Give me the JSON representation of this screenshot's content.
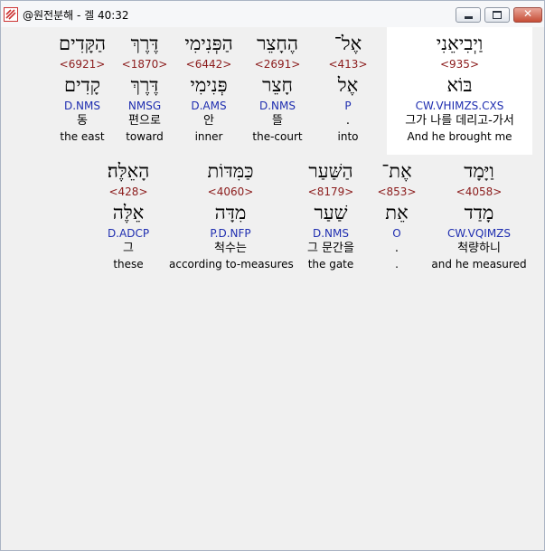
{
  "window": {
    "title": "@원전분해 - 겔 40:32",
    "icon": "app-icon",
    "controls": [
      "minimize-icon",
      "maximize-icon",
      "close-icon"
    ]
  },
  "colors": {
    "strong": "#8b1b1b",
    "morph": "#1f2eb0",
    "highlight_bg": "#ffffff",
    "background": "#f0f0f0"
  },
  "row1": [
    {
      "hebrew": "וַיְבִיאֵנִי",
      "strong": "<935>",
      "lemma": "בּוֹא",
      "morph": "CW.VHIMZS.CXS",
      "korean": "그가 나를 데리고-가서",
      "english": "And he brought me"
    },
    {
      "hebrew": "אֶל־",
      "strong": "<413>",
      "lemma": "אֶל",
      "morph": "P",
      "korean": ".",
      "english": "into"
    },
    {
      "hebrew": "הֶחָצֵר",
      "strong": "<2691>",
      "lemma": "חָצֵר",
      "morph": "D.NMS",
      "korean": "뜰",
      "english": "the-court"
    },
    {
      "hebrew": "הַפְּנִימִי",
      "strong": "<6442>",
      "lemma": "פְּנִימִי",
      "morph": "D.AMS",
      "korean": "안",
      "english": "inner"
    },
    {
      "hebrew": "דֶּרֶךְ",
      "strong": "<1870>",
      "lemma": "דֶּרֶךְ",
      "morph": "NMSG",
      "korean": "편으로",
      "english": "toward"
    },
    {
      "hebrew": "הַקָּדִים",
      "strong": "<6921>",
      "lemma": "קָדִים",
      "morph": "D.NMS",
      "korean": "동",
      "english": "the east"
    }
  ],
  "row2": [
    {
      "hebrew": "וַיָּמָד",
      "strong": "<4058>",
      "lemma": "מָדַד",
      "morph": "CW.VQIMZS",
      "korean": "척량하니",
      "english": "and he measured"
    },
    {
      "hebrew": "אֶת־",
      "strong": "<853>",
      "lemma": "אֵת",
      "morph": "O",
      "korean": ".",
      "english": "."
    },
    {
      "hebrew": "הַשַּׁעַר",
      "strong": "<8179>",
      "lemma": "שַׁעַר",
      "morph": "D.NMS",
      "korean": "그 문간을",
      "english": "the gate"
    },
    {
      "hebrew": "כַּמִּדּוֹת",
      "strong": "<4060>",
      "lemma": "מִדָּה",
      "morph": "P.D.NFP",
      "korean": "척수는",
      "english": "according to-measures"
    },
    {
      "hebrew": "הָאֵלֶּה׃",
      "strong": "<428>",
      "lemma": "אֵלֶּה",
      "morph": "D.ADCP",
      "korean": "그",
      "english": "these"
    }
  ]
}
